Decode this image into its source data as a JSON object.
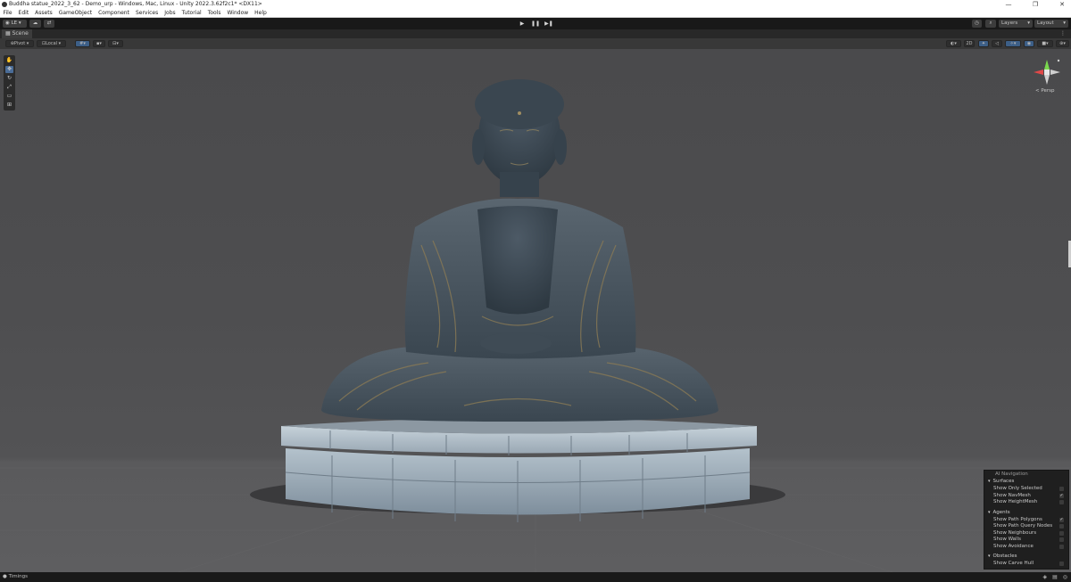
{
  "window": {
    "title": "Buddha statue_2022_3_62 - Demo_urp - Windows, Mac, Linux - Unity 2022.3.62f2c1* <DX11>",
    "controls": [
      "—",
      "❐",
      "✕"
    ]
  },
  "menu": [
    "File",
    "Edit",
    "Assets",
    "GameObject",
    "Component",
    "Services",
    "Jobs",
    "Tutorial",
    "Tools",
    "Window",
    "Help"
  ],
  "toolbar": {
    "account_label": "LE",
    "layers_label": "Layers",
    "layout_label": "Layout",
    "play_icons": [
      "▶",
      "❚❚",
      "▶❚"
    ]
  },
  "scene_tab": {
    "label": "Scene"
  },
  "scene_tools": {
    "pivot_label": "Pivot",
    "local_label": "Local",
    "mode_2d_label": "2D"
  },
  "gizmo": {
    "persp_label": "< Persp"
  },
  "ai_navigation": {
    "title": "AI Navigation",
    "sections": [
      {
        "name": "Surfaces",
        "items": [
          {
            "label": "Show Only Selected",
            "checked": false
          },
          {
            "label": "Show NavMesh",
            "checked": true
          },
          {
            "label": "Show HeightMesh",
            "checked": false
          }
        ]
      },
      {
        "name": "Agents",
        "items": [
          {
            "label": "Show Path Polygons",
            "checked": true
          },
          {
            "label": "Show Path Query Nodes",
            "checked": false
          },
          {
            "label": "Show Neighbours",
            "checked": false
          },
          {
            "label": "Show Walls",
            "checked": false
          },
          {
            "label": "Show Avoidance",
            "checked": false
          }
        ]
      },
      {
        "name": "Obstacles",
        "items": [
          {
            "label": "Show Carve Hull",
            "checked": false
          }
        ]
      }
    ]
  },
  "status": {
    "timings_label": "Timings"
  }
}
